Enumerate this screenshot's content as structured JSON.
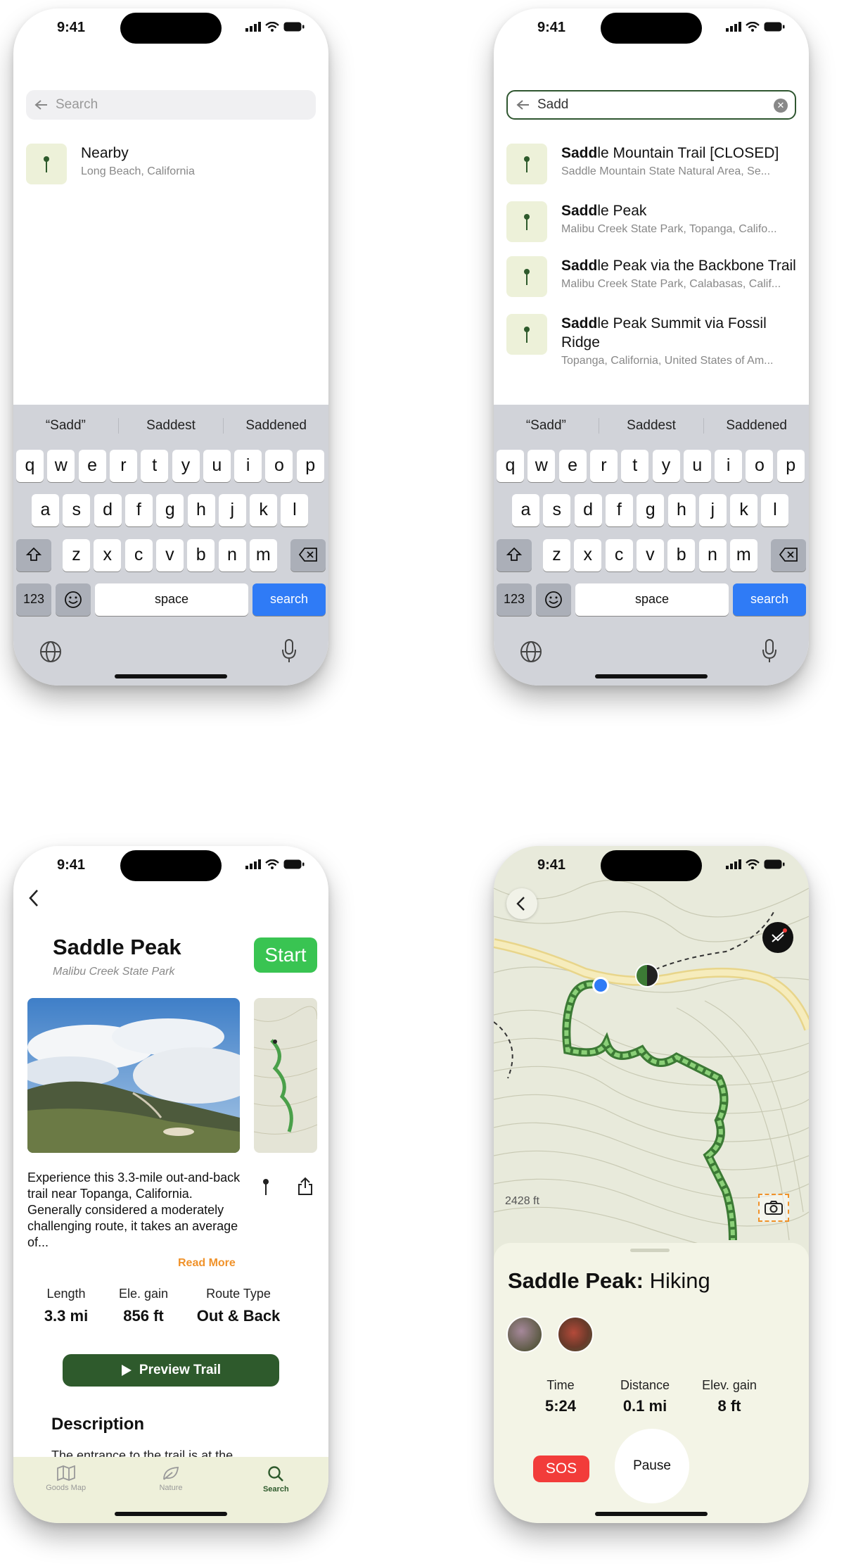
{
  "status": {
    "time": "9:41"
  },
  "screen1": {
    "search_placeholder": "Search",
    "result": {
      "title": "Nearby",
      "subtitle": "Long Beach, California"
    }
  },
  "screen2": {
    "search_value": "Sadd",
    "results": [
      {
        "bold": "Sadd",
        "rest": "le Mountain Trail [CLOSED]",
        "subtitle": "Saddle Mountain State Natural Area, Se..."
      },
      {
        "bold": "Sadd",
        "rest": "le Peak",
        "subtitle": "Malibu Creek State Park, Topanga, Califo..."
      },
      {
        "bold": "Sadd",
        "rest": "le Peak via the Backbone Trail",
        "subtitle": "Malibu Creek State Park, Calabasas, Calif..."
      },
      {
        "bold": "Sadd",
        "rest": "le Peak Summit via Fossil Ridge",
        "subtitle": "Topanga, California, United States of Am..."
      }
    ]
  },
  "keyboard": {
    "suggestions": [
      "“Sadd”",
      "Saddest",
      "Saddened"
    ],
    "row1": [
      "q",
      "w",
      "e",
      "r",
      "t",
      "y",
      "u",
      "i",
      "o",
      "p"
    ],
    "row2": [
      "a",
      "s",
      "d",
      "f",
      "g",
      "h",
      "j",
      "k",
      "l"
    ],
    "row3": [
      "z",
      "x",
      "c",
      "v",
      "b",
      "n",
      "m"
    ],
    "numbers": "123",
    "space": "space",
    "search": "search"
  },
  "detail": {
    "title": "Saddle Peak",
    "park": "Malibu Creek State Park",
    "start": "Start",
    "description": "Experience this 3.3-mile out-and-back trail near Topanga, California. Generally considered a moderately challenging route, it takes an average of...",
    "read_more": "Read More",
    "stats": [
      {
        "label": "Length",
        "value": "3.3 mi"
      },
      {
        "label": "Ele. gain",
        "value": "856 ft"
      },
      {
        "label": "Route Type",
        "value": "Out & Back"
      }
    ],
    "preview": "Preview Trail",
    "desc_heading": "Description",
    "desc_text": "The entrance to the trail is at the",
    "tabs": [
      {
        "label": "Goods Map",
        "icon": "map-icon"
      },
      {
        "label": "Nature",
        "icon": "leaf-icon"
      },
      {
        "label": "Search",
        "icon": "search-icon"
      }
    ]
  },
  "hiking": {
    "elevation": "2428 ft",
    "title_bold": "Saddle Peak:",
    "title_rest": " Hiking",
    "stats": [
      {
        "label": "Time",
        "value": "5:24"
      },
      {
        "label": "Distance",
        "value": "0.1 mi"
      },
      {
        "label": "Elev. gain",
        "value": "8 ft"
      }
    ],
    "sos": "SOS",
    "pause": "Pause"
  },
  "colors": {
    "accent_green": "#2e5a2c",
    "start_green": "#39c452",
    "blue": "#2f7bf6",
    "sos_red": "#f23c3a",
    "read_more": "#f0922a"
  }
}
